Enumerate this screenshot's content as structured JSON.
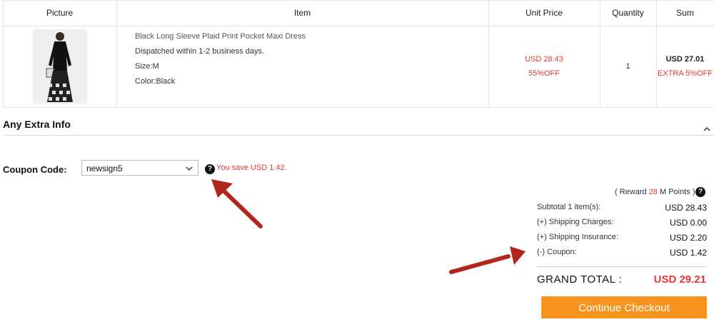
{
  "table": {
    "headers": {
      "picture": "Picture",
      "item": "Item",
      "unit_price": "Unit Price",
      "quantity": "Quantity",
      "sum": "Sum"
    },
    "row": {
      "name": "Black Long Sleeve Plaid Print Pocket Maxi Dress",
      "dispatch": "Dispatched within 1-2 business days.",
      "size": "Size:M",
      "color": "Color:Black",
      "unit_price": "USD 28.43",
      "discount": "55%OFF",
      "quantity": "1",
      "sum": "USD 27.01",
      "extra": "EXTRA 5%OFF"
    }
  },
  "extra_info": {
    "title": "Any Extra Info"
  },
  "coupon": {
    "label": "Coupon Code:",
    "selected": "newsign5",
    "save_text": "You save USD 1.42."
  },
  "summary": {
    "reward_prefix": "( Reward ",
    "reward_points": "28",
    "reward_suffix": " M Points )",
    "rows": [
      {
        "label": "Subtotal 1 item(s):",
        "amount": "USD 28.43"
      },
      {
        "label": "(+) Shipping Charges:",
        "amount": "USD 0.00"
      },
      {
        "label": "(+) Shipping Insurance:",
        "amount": "USD 2.20"
      },
      {
        "label": "(-) Coupon:",
        "amount": "USD 1.42"
      }
    ],
    "grand_total_label": "GRAND TOTAL :",
    "grand_total_amount": "USD 29.21",
    "checkout_label": "Continue Checkout"
  },
  "icons": {
    "help": "question-circle-icon",
    "collapse": "chevron-up-icon",
    "dropdown": "chevron-down-icon"
  },
  "colors": {
    "accent_red": "#e53935",
    "checkout_orange": "#f7941d",
    "arrow_red": "#b3261e"
  }
}
